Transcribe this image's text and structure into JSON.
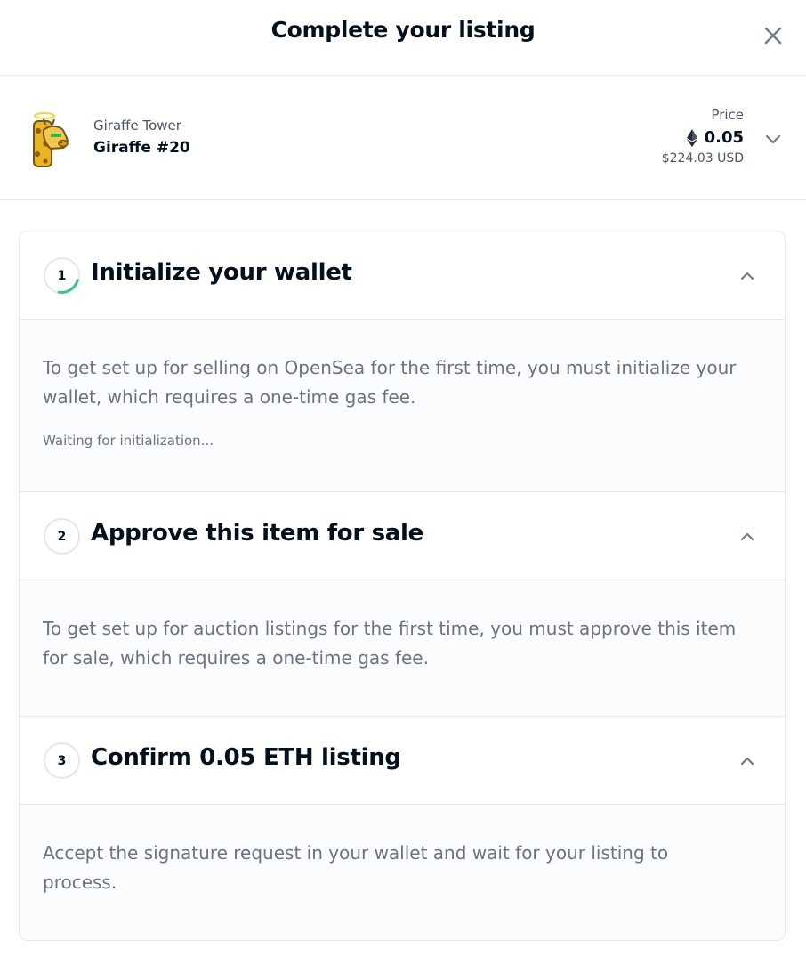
{
  "header": {
    "title": "Complete your listing",
    "close_icon": "close-icon"
  },
  "item": {
    "collection": "Giraffe Tower",
    "name": "Giraffe #20",
    "price_label": "Price",
    "price_eth": "0.05",
    "price_usd": "$224.03 USD",
    "currency_icon": "ethereum-icon"
  },
  "steps": [
    {
      "number": "1",
      "title": "Initialize your wallet",
      "description": "To get set up for selling on OpenSea for the first time, you must initialize your wallet, which requires a one-time gas fee.",
      "status": "Waiting for initialization...",
      "in_progress": true
    },
    {
      "number": "2",
      "title": "Approve this item for sale",
      "description": "To get set up for auction listings for the first time, you must approve this item for sale, which requires a one-time gas fee."
    },
    {
      "number": "3",
      "title": "Confirm 0.05 ETH listing",
      "description": "Accept the signature request in your wallet and wait for your listing to process."
    }
  ],
  "colors": {
    "text": "#04111d",
    "muted": "#6b7280",
    "border": "#e5e8eb",
    "progress": "#34c77b",
    "panel_bg": "#fbfcfd"
  }
}
